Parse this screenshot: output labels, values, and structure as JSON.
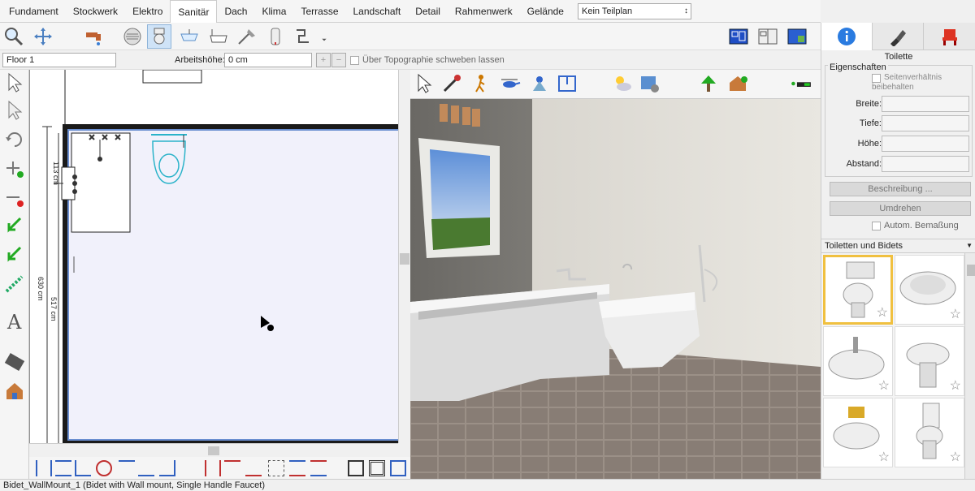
{
  "menu": {
    "tabs": [
      "Fundament",
      "Stockwerk",
      "Elektro",
      "Sanitär",
      "Dach",
      "Klima",
      "Terrasse",
      "Landschaft",
      "Detail",
      "Rahmenwerk",
      "Gelände"
    ],
    "active": "Sanitär",
    "plan_select": "Kein Teilplan"
  },
  "subbar": {
    "floor": "Floor 1",
    "height_label": "Arbeitshöhe:",
    "height_value": "0 cm",
    "topo_label": "Über Topographie schweben lassen"
  },
  "plan": {
    "dim1": "113 cm",
    "dim2": "630 cm",
    "dim3": "517 cm"
  },
  "panel": {
    "title": "Toilette",
    "group": "Eigenschaften",
    "aspect": "Seitenverhältnis beibehalten",
    "width_label": "Breite:",
    "depth_label": "Tiefe:",
    "height_label": "Höhe:",
    "distance_label": "Abstand:",
    "describe_btn": "Beschreibung ...",
    "flip_btn": "Umdrehen",
    "auto_dim": "Autom. Bemaßung",
    "category": "Toiletten und Bidets"
  },
  "statusbar": "Bidet_WallMount_1 (Bidet with Wall mount, Single Handle Faucet)",
  "icons": {
    "info": "info-icon",
    "pen": "pen-icon",
    "chair": "chair-icon"
  }
}
